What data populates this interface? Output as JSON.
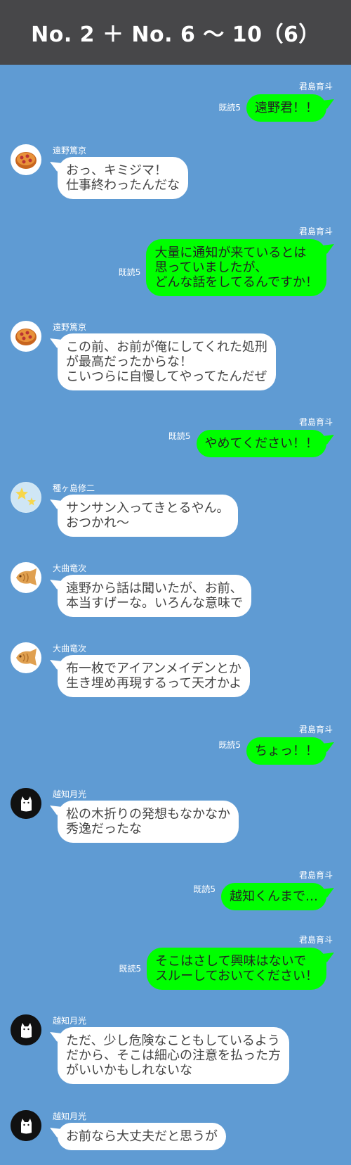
{
  "header": {
    "title": "No. 2 ＋ No. 6 〜 10（6）"
  },
  "colors": {
    "background": "#5f9bd3",
    "header": "#474749",
    "outgoing_bubble": "#00ff00",
    "incoming_bubble": "#ffffff"
  },
  "messages": [
    {
      "direction": "out",
      "sender": "君島育斗",
      "read": "既読5",
      "text": "遠野君！！"
    },
    {
      "direction": "in",
      "sender": "遠野篤京",
      "avatar": "pie-icon",
      "text": "おっ、キミジマ！\n仕事終わったんだな"
    },
    {
      "direction": "out",
      "sender": "君島育斗",
      "read": "既読5",
      "text": "大量に通知が来ているとは\n思っていましたが、\nどんな話をしてるんですか！"
    },
    {
      "direction": "in",
      "sender": "遠野篤京",
      "avatar": "pie-icon",
      "text": "この前、お前が俺にしてくれた処刑\nが最高だったからな！\nこいつらに自慢してやってたんだぜ"
    },
    {
      "direction": "out",
      "sender": "君島育斗",
      "read": "既読5",
      "text": "やめてください！！"
    },
    {
      "direction": "in",
      "sender": "種ヶ島修二",
      "avatar": "star-icon",
      "text": "サンサン入ってきとるやん。\nおつかれ〜"
    },
    {
      "direction": "in",
      "sender": "大曲竜次",
      "avatar": "taiyaki-icon",
      "text": "遠野から話は聞いたが、お前、\n本当すげーな。いろんな意味で"
    },
    {
      "direction": "in",
      "sender": "大曲竜次",
      "avatar": "taiyaki-icon",
      "text": "布一枚でアイアンメイデンとか\n生き埋め再現するって天才かよ"
    },
    {
      "direction": "out",
      "sender": "君島育斗",
      "read": "既読5",
      "text": "ちょっ！！"
    },
    {
      "direction": "in",
      "sender": "越知月光",
      "avatar": "cat-icon",
      "text": "松の木折りの発想もなかなか\n秀逸だったな"
    },
    {
      "direction": "out",
      "sender": "君島育斗",
      "read": "既読5",
      "text": "越知くんまで…"
    },
    {
      "direction": "out",
      "sender": "君島育斗",
      "read": "既読5",
      "text": "そこはさして興味はないで\nスルーしておいてください！"
    },
    {
      "direction": "in",
      "sender": "越知月光",
      "avatar": "cat-icon",
      "text": "ただ、少し危険なこともしているよう\nだから、そこは細心の注意を払った方\nがいいかもしれないな"
    },
    {
      "direction": "in",
      "sender": "越知月光",
      "avatar": "cat-icon",
      "text": "お前なら大丈夫だと思うが"
    }
  ]
}
